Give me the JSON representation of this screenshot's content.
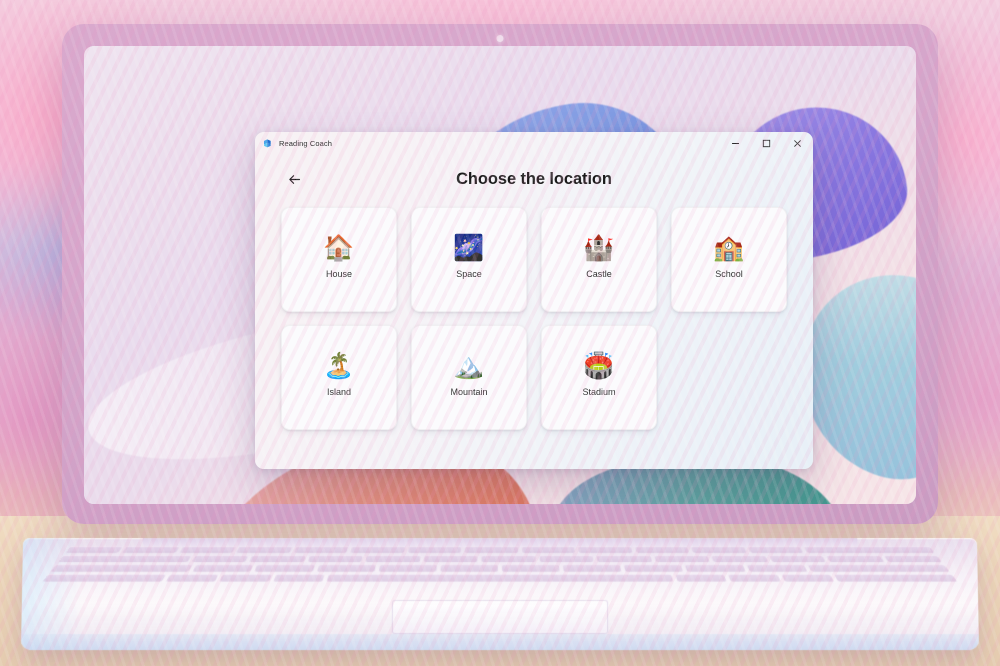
{
  "device": {
    "type": "laptop",
    "webcam": "webcam-dot"
  },
  "desktop": {
    "wallpaper_name": "windows-11-bloom",
    "colors": {
      "background": "#efe4f0",
      "ribbon_blue": "#7f9ae4",
      "ribbon_violet": "#7f6ddf",
      "ribbon_cyan": "#8fc9dd",
      "ribbon_orange": "#d96a4f",
      "ribbon_teal": "#2f8f84"
    }
  },
  "photo_background": {
    "description": "blurred pink and purple floral bokeh",
    "desk_color": "#ecd5b8"
  },
  "app": {
    "titlebar": {
      "icon": "reading-coach-app-icon",
      "title": "Reading Coach",
      "controls": {
        "minimize_label": "Minimize",
        "maximize_label": "Maximize",
        "close_label": "Close"
      }
    },
    "header": {
      "back_label": "Back",
      "back_icon": "arrow-left-icon",
      "title": "Choose the location"
    },
    "locations": [
      {
        "label": "House",
        "emoji": "🏠",
        "icon_name": "house-emoji"
      },
      {
        "label": "Space",
        "emoji": "🌌",
        "icon_name": "milky-way-emoji"
      },
      {
        "label": "Castle",
        "emoji": "🏰",
        "icon_name": "castle-emoji"
      },
      {
        "label": "School",
        "emoji": "🏫",
        "icon_name": "school-emoji"
      },
      {
        "label": "Island",
        "emoji": "🏝️",
        "icon_name": "desert-island-emoji"
      },
      {
        "label": "Mountain",
        "emoji": "🏔️",
        "icon_name": "snow-mountain-emoji"
      },
      {
        "label": "Stadium",
        "emoji": "🏟️",
        "icon_name": "stadium-emoji"
      }
    ],
    "colors": {
      "window_bg_start": "#f7f1f4",
      "window_bg_end": "#e7f0f7",
      "card_bg": "#fbfbfd",
      "title_text": "#1a1a1a",
      "label_text": "#2d2d2d"
    }
  }
}
